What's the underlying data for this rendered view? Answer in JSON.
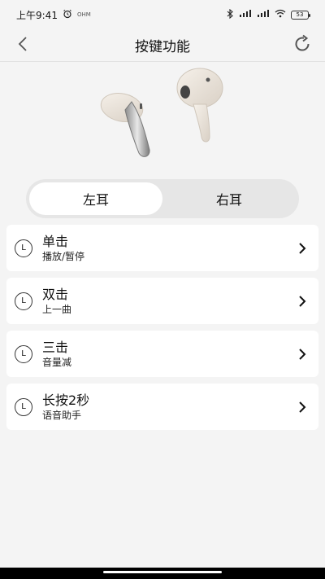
{
  "status_bar": {
    "time": "上午9:41",
    "small_label": "OHM",
    "battery": "53"
  },
  "header": {
    "title": "按键功能"
  },
  "tabs": [
    {
      "label": "左耳",
      "active": true
    },
    {
      "label": "右耳",
      "active": false
    }
  ],
  "functions": [
    {
      "badge": "L",
      "title": "单击",
      "action": "播放/暂停"
    },
    {
      "badge": "L",
      "title": "双击",
      "action": "上一曲"
    },
    {
      "badge": "L",
      "title": "三击",
      "action": "音量减"
    },
    {
      "badge": "L",
      "title": "长按2秒",
      "action": "语音助手"
    }
  ],
  "colors": {
    "background": "#f4f4f4",
    "card": "#ffffff",
    "segment_bg": "#e6e6e6"
  },
  "icons": {
    "back": "chevron-left-icon",
    "refresh": "refresh-icon",
    "item_arrow": "chevron-right-icon"
  }
}
